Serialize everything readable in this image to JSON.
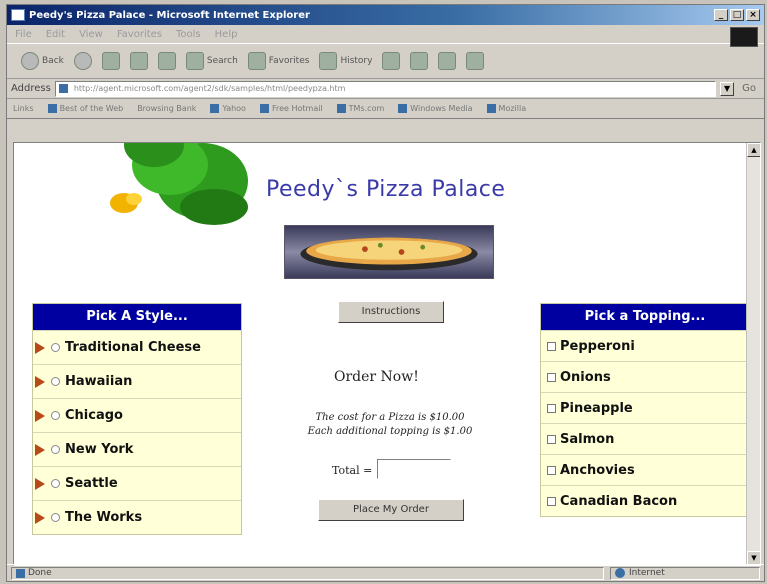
{
  "window": {
    "title": "Peedy's Pizza Palace - Microsoft Internet Explorer",
    "buttons": [
      "_",
      "□",
      "×"
    ]
  },
  "menu": {
    "items": [
      "File",
      "Edit",
      "View",
      "Favorites",
      "Tools",
      "Help"
    ]
  },
  "toolbar": {
    "back": "Back",
    "search": "Search",
    "favorites": "Favorites",
    "history": "History"
  },
  "address": {
    "label": "Address",
    "url": "http://agent.microsoft.com/agent2/sdk/samples/html/peedypza.htm",
    "go": "Go"
  },
  "links": {
    "label": "Links",
    "items": [
      "Best of the Web",
      "Browsing Bank",
      "Yahoo",
      "Free Hotmail",
      "TMs.com",
      "Windows Media",
      "Mozilla"
    ]
  },
  "page": {
    "title": "Peedy`s Pizza Palace",
    "instructions_button": "Instructions",
    "order_now": "Order Now!",
    "cost_line1": "The cost for a Pizza is $10.00",
    "cost_line2": "Each additional topping is $1.00",
    "total_label": "Total =",
    "total_value": "",
    "place_order_button": "Place My Order"
  },
  "styles": {
    "heading": "Pick A Style...",
    "items": [
      "Traditional Cheese",
      "Hawaiian",
      "Chicago",
      "New York",
      "Seattle",
      "The Works"
    ]
  },
  "toppings": {
    "heading": "Pick a Topping...",
    "items": [
      "Pepperoni",
      "Onions",
      "Pineapple",
      "Salmon",
      "Anchovies",
      "Canadian Bacon"
    ]
  },
  "status": {
    "left": "Done",
    "zone": "Internet"
  },
  "colors": {
    "title_blue": "#3a3aa8",
    "panel_header": "#0000a0",
    "panel_bg": "#ffffe0",
    "arrow": "#b84a1a"
  }
}
